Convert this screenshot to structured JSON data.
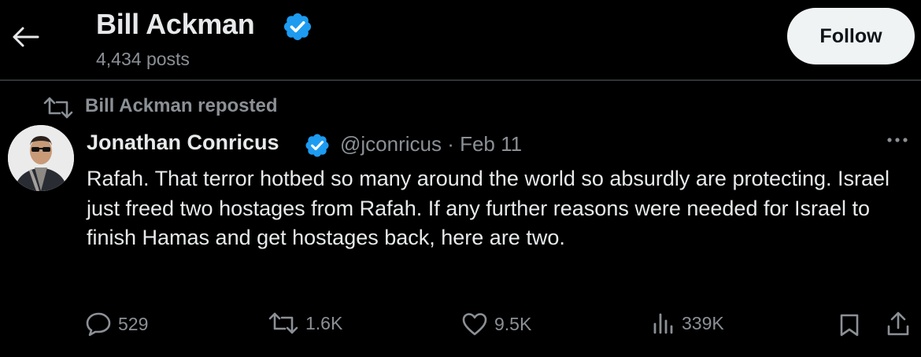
{
  "header": {
    "profile_name": "Bill Ackman",
    "post_count": "4,434 posts",
    "follow_label": "Follow"
  },
  "repost": {
    "label": "Bill Ackman reposted"
  },
  "tweet": {
    "author_name": "Jonathan Conricus",
    "handle_date": "@jconricus · Feb 11",
    "text": "Rafah. That terror hotbed so many around the world so absurdly are protecting. Israel just freed two hostages from Rafah. If any further reasons were needed for Israel to finish Hamas and get hostages back, here are two.",
    "replies": "529",
    "reposts": "1.6K",
    "likes": "9.5K",
    "views": "339K"
  },
  "colors": {
    "background": "#000000",
    "primary_text": "#e7e9ea",
    "secondary_text": "#8b9096",
    "verified_badge": "#1d9bf0",
    "follow_button": "#eff3f4"
  }
}
